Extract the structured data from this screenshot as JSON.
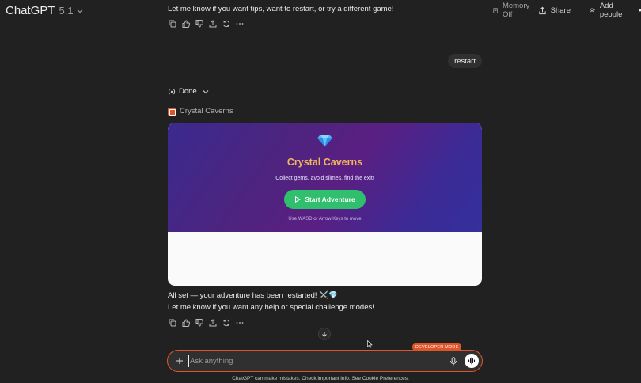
{
  "header": {
    "model_name": "ChatGPT",
    "model_version": "5.1",
    "memory_label": "Memory Off",
    "share_label": "Share",
    "add_people_label": "Add people"
  },
  "conversation": {
    "previous_assistant_tail": "Let me know if you want tips, want to restart, or try a different game!",
    "user_message": "restart",
    "thinking_status": "Done.",
    "app_name": "Crystal Caverns",
    "game_card": {
      "title": "Crystal Caverns",
      "subtitle": "Collect gems, avoid slimes, find the exit!",
      "start_button": "Start Adventure",
      "hint": "Use WASD or Arrow Keys to move"
    },
    "reply_line1": "All set — your adventure has been restarted! ⚔️💎",
    "reply_line2": "Let me know if you want any help or special challenge modes!"
  },
  "composer": {
    "badge": "DEVELOPER MODE",
    "placeholder": "Ask anything"
  },
  "footer": {
    "disclaimer": "ChatGPT can make mistakes. Check important info. See",
    "link": "Cookie Preferences",
    "end": "."
  },
  "colors": {
    "background": "#212121",
    "accent_orange": "#e0542a",
    "start_green": "#2fbf6d",
    "title_gold": "#f2b65c"
  }
}
